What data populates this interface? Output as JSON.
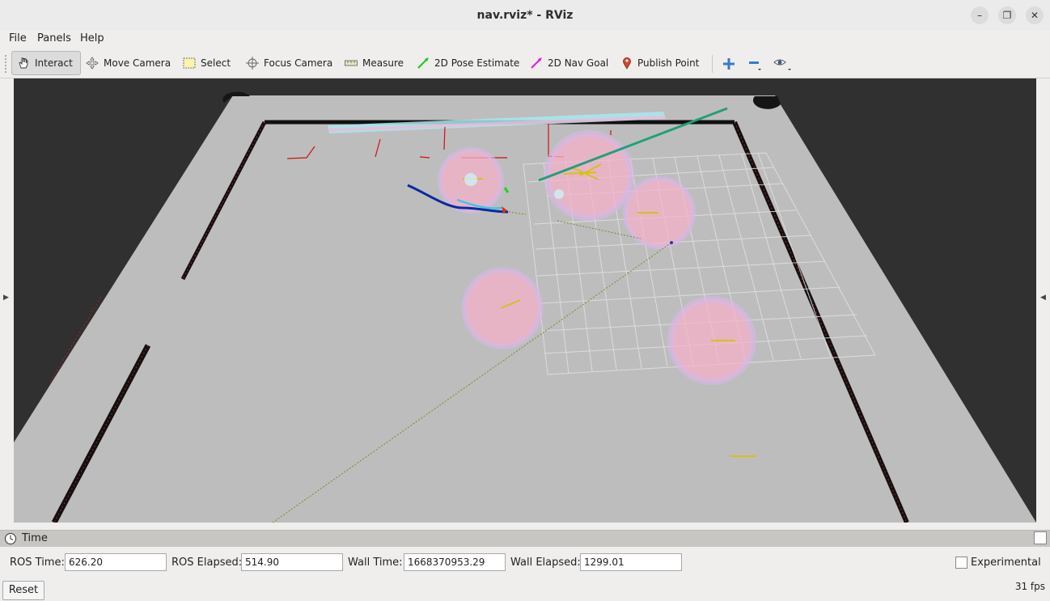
{
  "window": {
    "title": "nav.rviz* - RViz"
  },
  "menubar": {
    "items": [
      "File",
      "Panels",
      "Help"
    ]
  },
  "toolbar": {
    "tools": [
      {
        "label": "Interact",
        "icon": "hand-icon",
        "active": true
      },
      {
        "label": "Move Camera",
        "icon": "move-camera-icon",
        "active": false
      },
      {
        "label": "Select",
        "icon": "select-box-icon",
        "active": false
      },
      {
        "label": "Focus Camera",
        "icon": "crosshair-icon",
        "active": false
      },
      {
        "label": "Measure",
        "icon": "ruler-icon",
        "active": false
      },
      {
        "label": "2D Pose Estimate",
        "icon": "green-arrow-icon",
        "active": false
      },
      {
        "label": "2D Nav Goal",
        "icon": "pink-arrow-icon",
        "active": false
      },
      {
        "label": "Publish Point",
        "icon": "map-pin-icon",
        "active": false
      }
    ],
    "extra_icons": [
      "plus-icon",
      "minus-icon",
      "eye-icon"
    ]
  },
  "time_panel": {
    "title": "Time",
    "ros_time_label": "ROS Time:",
    "ros_time": "626.20",
    "ros_elapsed_label": "ROS Elapsed:",
    "ros_elapsed": "514.90",
    "wall_time_label": "Wall Time:",
    "wall_time": "1668370953.29",
    "wall_elapsed_label": "Wall Elapsed:",
    "wall_elapsed": "1299.01",
    "experimental_label": "Experimental",
    "experimental_checked": false,
    "reset_label": "Reset",
    "fps": "31 fps"
  },
  "colors": {
    "accent_hand_tool": "#dcdcdc",
    "floor": "#bdbdbd",
    "background": "#303030",
    "path": "#0a2fa0",
    "costmap_circle": "#f0b0c8"
  }
}
